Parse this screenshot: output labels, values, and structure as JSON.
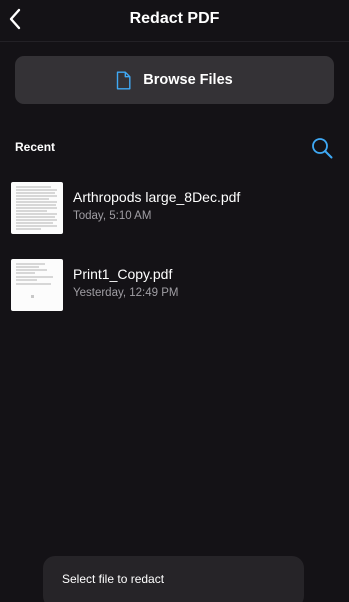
{
  "header": {
    "title": "Redact PDF",
    "back_icon": "chevron-left-icon"
  },
  "browse": {
    "label": "Browse Files",
    "icon": "file-icon",
    "accent_color": "#3fa9f5"
  },
  "recent": {
    "label": "Recent",
    "search_icon": "search-icon",
    "files": [
      {
        "name": "Arthropods large_8Dec.pdf",
        "date": "Today, 5:10 AM"
      },
      {
        "name": "Print1_Copy.pdf",
        "date": "Yesterday, 12:49 PM"
      }
    ]
  },
  "toast": {
    "text": "Select file to redact"
  }
}
